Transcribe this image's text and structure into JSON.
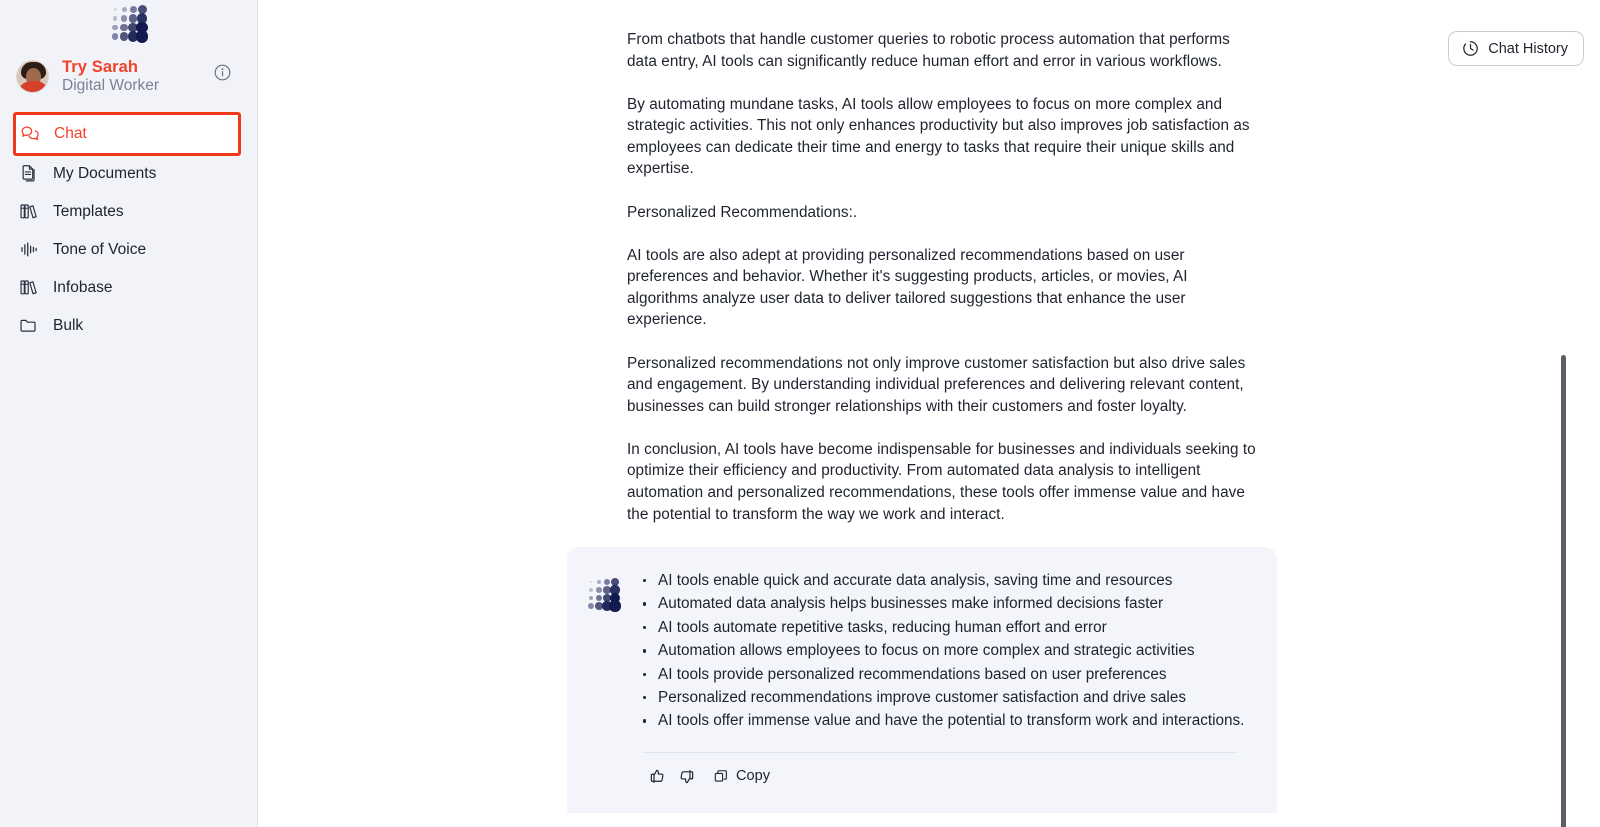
{
  "brand": {
    "logo_name": "dot-grid-logo",
    "accent_red": "#f0432a",
    "logo_navy": "#121a4f"
  },
  "sidebar": {
    "profile": {
      "name": "Try Sarah",
      "role": "Digital Worker",
      "info_icon": "info-icon",
      "avatar": "user-avatar"
    },
    "items": [
      {
        "label": "Chat",
        "icon": "chat-bubbles-icon",
        "active": true
      },
      {
        "label": "My Documents",
        "icon": "documents-icon",
        "active": false
      },
      {
        "label": "Templates",
        "icon": "books-icon",
        "active": false
      },
      {
        "label": "Tone of Voice",
        "icon": "waveform-icon",
        "active": false
      },
      {
        "label": "Infobase",
        "icon": "books-icon",
        "active": false
      },
      {
        "label": "Bulk",
        "icon": "folder-icon",
        "active": false
      }
    ]
  },
  "header": {
    "chat_history_label": "Chat History",
    "chat_history_icon": "clock-history-icon"
  },
  "conversation": {
    "paragraphs": [
      "From chatbots that handle customer queries to robotic process automation that performs data entry, AI tools can significantly reduce human effort and error in various workflows.",
      "By automating mundane tasks, AI tools allow employees to focus on more complex and strategic activities. This not only enhances productivity but also improves job satisfaction as employees can dedicate their time and energy to tasks that require their unique skills and expertise.",
      "Personalized Recommendations:.",
      "AI tools are also adept at providing personalized recommendations based on user preferences and behavior. Whether it's suggesting products, articles, or movies, AI algorithms analyze user data to deliver tailored suggestions that enhance the user experience.",
      "Personalized recommendations not only improve customer satisfaction but also drive sales and engagement. By understanding individual preferences and delivering relevant content, businesses can build stronger relationships with their customers and foster loyalty.",
      "In conclusion, AI tools have become indispensable for businesses and individuals seeking to optimize their efficiency and productivity. From automated data analysis to intelligent automation and personalized recommendations, these tools offer immense value and have the potential to transform the way we work and interact."
    ],
    "answer_card": {
      "logo_icon": "dot-grid-logo-small",
      "bullets": [
        "AI tools enable quick and accurate data analysis, saving time and resources",
        "Automated data analysis helps businesses make informed decisions faster",
        "AI tools automate repetitive tasks, reducing human effort and error",
        "Automation allows employees to focus on more complex and strategic activities",
        "AI tools provide personalized recommendations based on user preferences",
        "Personalized recommendations improve customer satisfaction and drive sales",
        "AI tools offer immense value and have the potential to transform work and interactions."
      ],
      "actions": {
        "thumbs_up_icon": "thumbs-up-icon",
        "thumbs_down_icon": "thumbs-down-icon",
        "copy_icon": "copy-icon",
        "copy_label": "Copy"
      }
    }
  }
}
